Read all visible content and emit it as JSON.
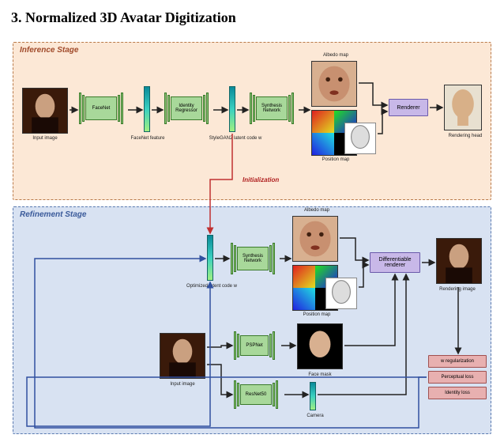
{
  "section_title": "3. Normalized 3D Avatar Digitization",
  "stages": {
    "inference": {
      "label": "Inference Stage"
    },
    "refinement": {
      "label": "Refinement Stage"
    }
  },
  "nodes": {
    "input_image_1": "Input image",
    "facenet": "FaceNet",
    "facenet_feature": "FaceNet feature",
    "identity_regressor": "Identity\nRegressor",
    "stylegan_code": "StyleGAN2 latent code w",
    "synthesis_network_1": "Synthesis\nNetwork",
    "albedo_map_1": "Albedo map",
    "position_map_1": "Position map",
    "renderer": "Renderer",
    "rendering_head": "Rendering head",
    "initialization": "Initialization",
    "optimized_code": "Optimized latent code w",
    "synthesis_network_2": "Synthesis\nNetwork",
    "albedo_map_2": "Albedo map",
    "position_map_2": "Position map",
    "diff_renderer": "Differentiable\nrenderer",
    "rendering_image": "Rendering image",
    "input_image_2": "Input image",
    "pspnet": "PSPNet",
    "face_mask": "Face mask",
    "resnet50": "ResNet50",
    "camera": "Camera",
    "w_reg": "w regularization",
    "perceptual_loss": "Perceptual loss",
    "identity_loss": "Identity loss"
  }
}
